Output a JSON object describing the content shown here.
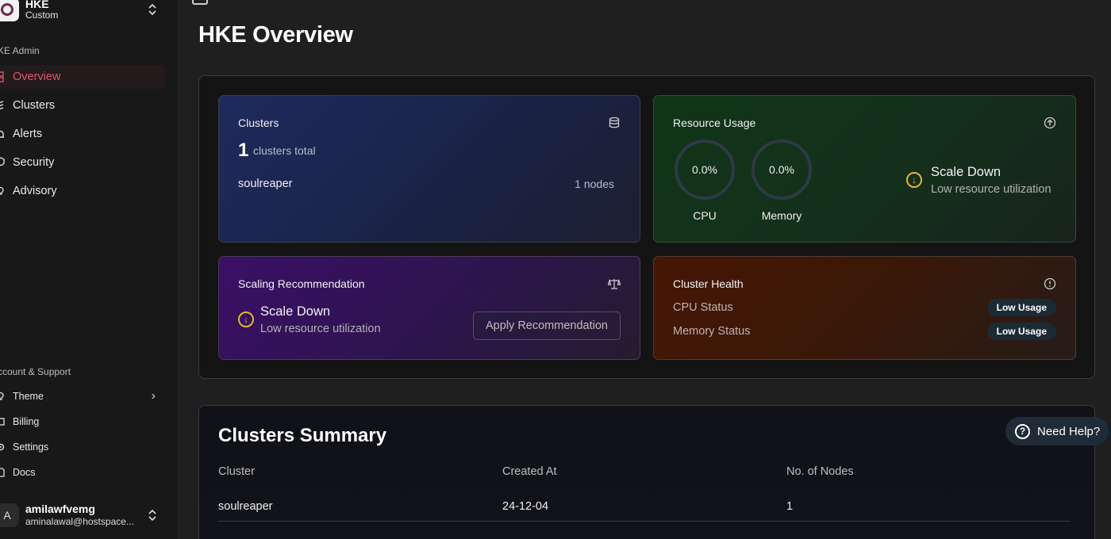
{
  "org": {
    "name": "HKE",
    "plan": "Custom"
  },
  "sidebar": {
    "group_admin": "KE Admin",
    "items": [
      {
        "label": "Overview",
        "icon": "grid-icon",
        "active": true
      },
      {
        "label": "Clusters",
        "icon": "layers-icon"
      },
      {
        "label": "Alerts",
        "icon": "bell-icon"
      },
      {
        "label": "Security",
        "icon": "shield-icon"
      },
      {
        "label": "Advisory",
        "icon": "lightbulb-icon"
      }
    ],
    "group_support": "ccount & Support",
    "support_items": [
      {
        "label": "Theme",
        "icon": "bulb-icon"
      },
      {
        "label": "Billing",
        "icon": "card-icon"
      },
      {
        "label": "Settings",
        "icon": "gear-icon"
      },
      {
        "label": "Docs",
        "icon": "doc-icon"
      }
    ]
  },
  "user": {
    "initial": "A",
    "name": "amilawfvemg",
    "email": "aminalawal@hostspace..."
  },
  "page": {
    "title": "HKE Overview"
  },
  "clusters_card": {
    "title": "Clusters",
    "count": "1",
    "count_label": "clusters total",
    "cluster_name": "soulreaper",
    "cluster_nodes": "1 nodes"
  },
  "resource_card": {
    "title": "Resource Usage",
    "cpu_value": "0.0%",
    "cpu_label": "CPU",
    "memory_value": "0.0%",
    "memory_label": "Memory",
    "rec_title": "Scale Down",
    "rec_sub": "Low resource utilization"
  },
  "scaling_card": {
    "title": "Scaling Recommendation",
    "rec_title": "Scale Down",
    "rec_sub": "Low resource utilization",
    "button": "Apply Recommendation"
  },
  "health_card": {
    "title": "Cluster Health",
    "cpu_label": "CPU Status",
    "cpu_badge": "Low Usage",
    "memory_label": "Memory Status",
    "memory_badge": "Low Usage"
  },
  "summary": {
    "title": "Clusters Summary",
    "columns": [
      "Cluster",
      "Created At",
      "No. of Nodes"
    ],
    "rows": [
      {
        "cluster": "soulreaper",
        "created": "24-12-04",
        "nodes": "1"
      }
    ]
  },
  "help": {
    "label": "Need Help?"
  }
}
